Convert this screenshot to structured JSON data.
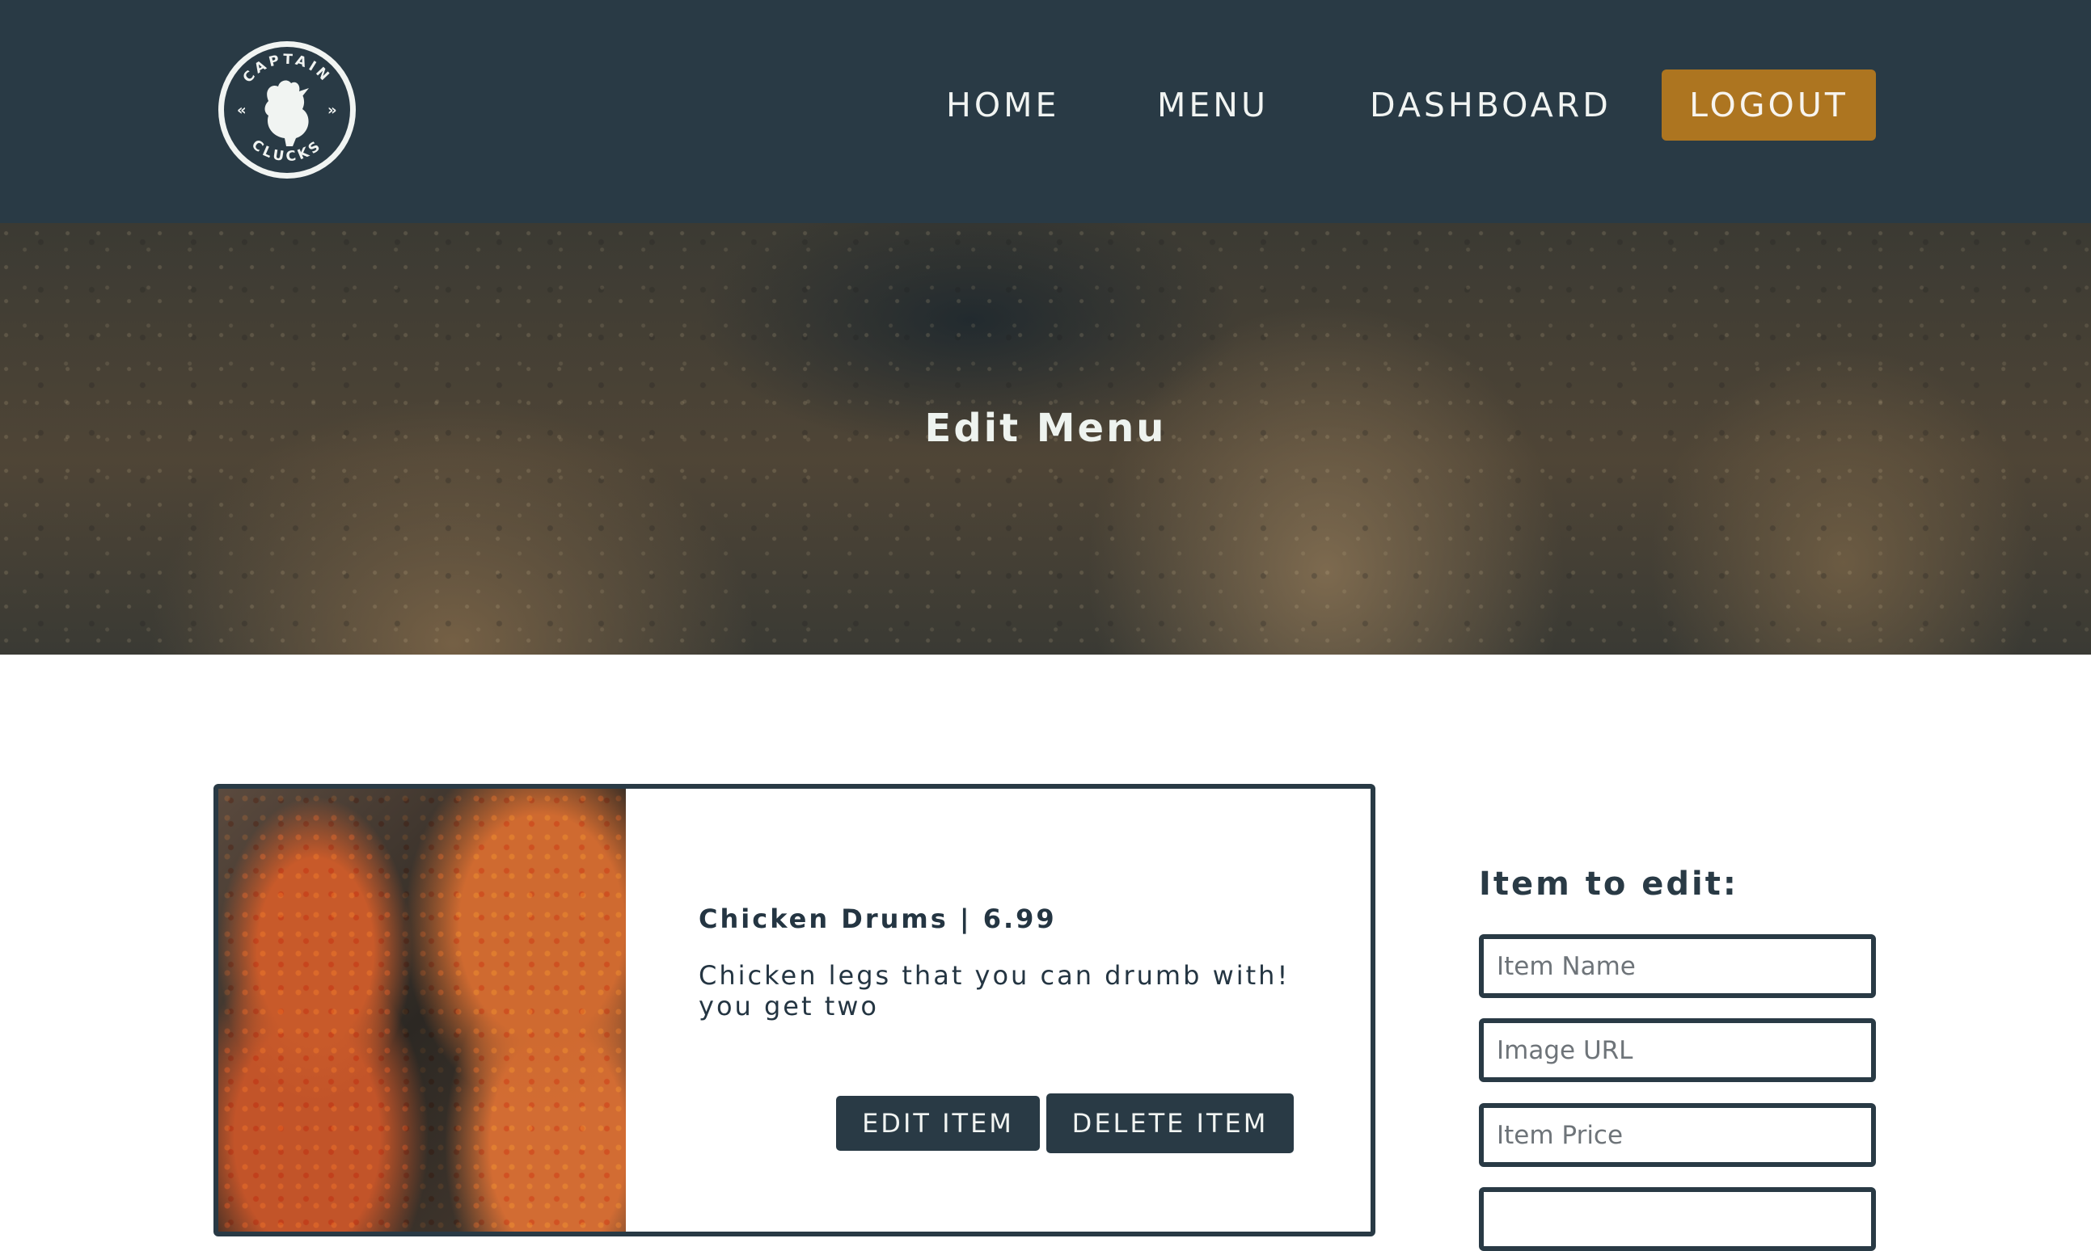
{
  "nav": {
    "logo_top_text": "CAPTAIN",
    "logo_bottom_text": "CLUCKS",
    "home": "HOME",
    "menu": "MENU",
    "dashboard": "DASHBOARD",
    "logout": "LOGOUT"
  },
  "hero": {
    "title": "Edit Menu"
  },
  "item": {
    "title": "Chicken Drums | 6.99",
    "description": "Chicken legs that you can drumb with! you get two",
    "edit_label": "EDIT ITEM",
    "delete_label": "DELETE ITEM"
  },
  "form": {
    "title": "Item to edit:",
    "name_placeholder": "Item Name",
    "image_placeholder": "Image URL",
    "price_placeholder": "Item Price",
    "extra_placeholder": ""
  },
  "colors": {
    "navy": "#293a45",
    "gold": "#ad7520",
    "cream": "#f1f4f2"
  }
}
